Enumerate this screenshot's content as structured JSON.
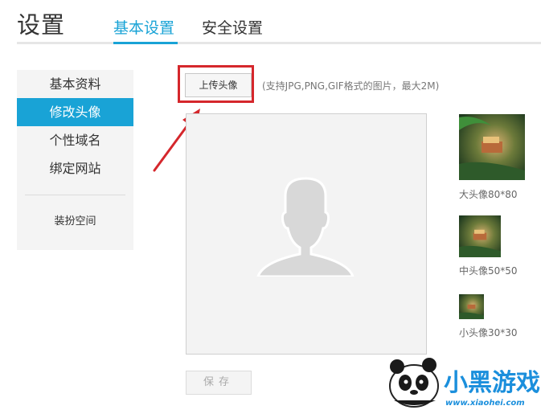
{
  "header": {
    "title": "设置",
    "tabs": [
      {
        "label": "基本设置",
        "active": true
      },
      {
        "label": "安全设置",
        "active": false
      }
    ]
  },
  "sidebar": {
    "items": [
      {
        "label": "基本资料",
        "active": false
      },
      {
        "label": "修改头像",
        "active": true
      },
      {
        "label": "个性域名",
        "active": false
      },
      {
        "label": "绑定网站",
        "active": false
      }
    ],
    "space_link": "装扮空间"
  },
  "upload": {
    "button_label": "上传头像",
    "hint": "(支持JPG,PNG,GIF格式的图片，最大2M)"
  },
  "thumbnails": [
    {
      "label": "大头像80*80"
    },
    {
      "label": "中头像50*50"
    },
    {
      "label": "小头像30*30"
    }
  ],
  "save_label": "保存",
  "watermark": {
    "brand": "小黑游戏",
    "url": "www.xiaohei.com"
  },
  "colors": {
    "accent": "#19a3d6",
    "highlight": "#d5272c"
  }
}
